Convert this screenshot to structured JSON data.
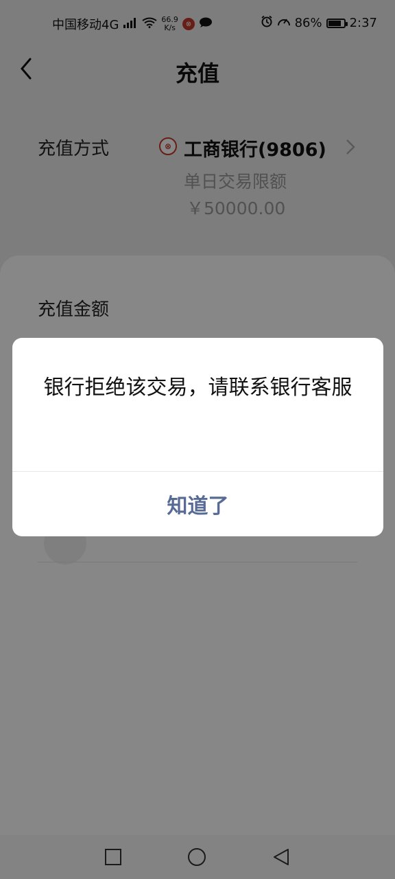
{
  "status_bar": {
    "carrier": "中国移动4G",
    "network_badge": "4G",
    "speed_value": "66.9",
    "speed_unit": "K/s",
    "battery_percent": "86%",
    "battery_level": 0.86,
    "time": "2:37"
  },
  "header": {
    "title": "充值"
  },
  "recharge_method": {
    "label": "充值方式",
    "bank_name": "工商银行(9806)",
    "limit_label": "单日交易限额",
    "limit_value": "￥50000.00"
  },
  "amount": {
    "label": "充值金额"
  },
  "dialog": {
    "message": "银行拒绝该交易，请联系银行客服",
    "ok_label": "知道了"
  },
  "colors": {
    "overlay": "rgba(0,0,0,0.47)",
    "dialog_button": "#576b95",
    "bank_red": "#c0392b"
  },
  "icons": {
    "back": "chevron-left-icon",
    "method_arrow": "chevron-right-icon",
    "nav_recent": "square-icon",
    "nav_home": "circle-icon",
    "nav_back": "triangle-back-icon"
  }
}
